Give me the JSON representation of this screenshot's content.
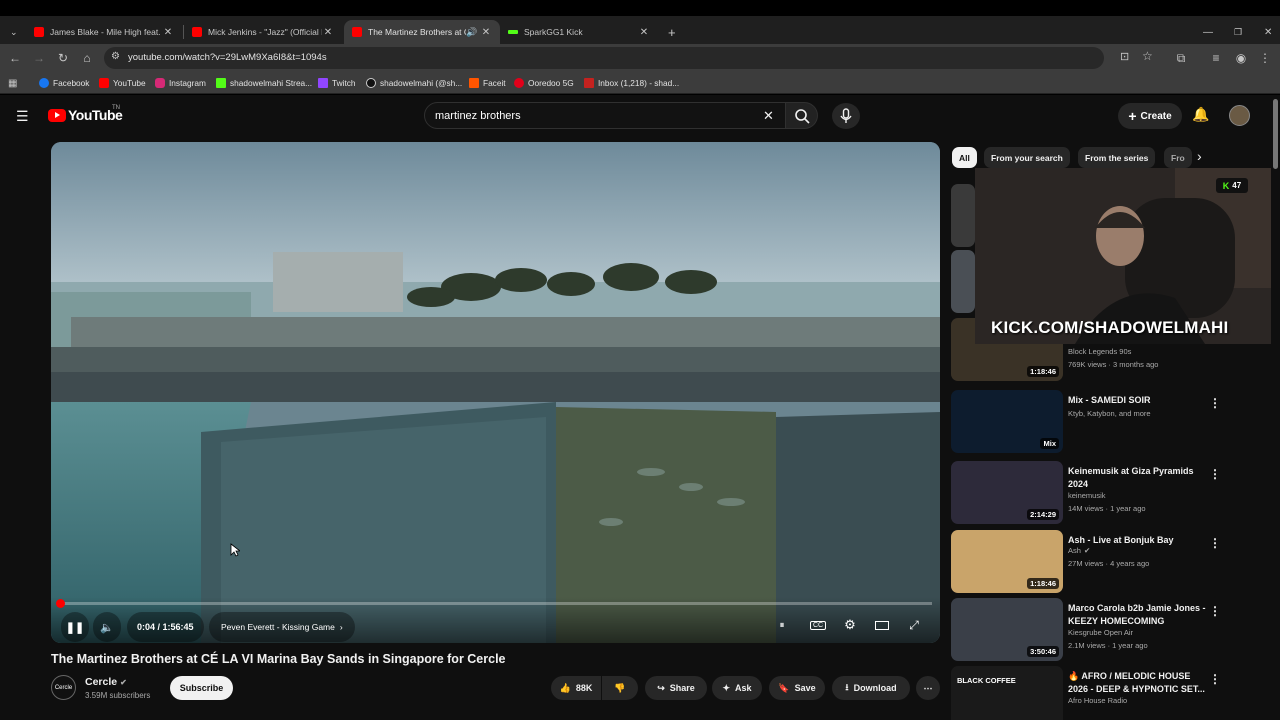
{
  "browser": {
    "tabs": [
      {
        "title": "James Blake - Mile High feat. Tr",
        "fav_color": "#ff0000"
      },
      {
        "title": "Mick Jenkins - \"Jazz\" (Official M",
        "fav_color": "#ff0000"
      },
      {
        "title": "The Martinez Brothers at CÉ",
        "fav_color": "#ff0000",
        "active": true
      },
      {
        "title": "SparkGG1 Kick",
        "fav_color": "#53fc18"
      }
    ],
    "url": "youtube.com/watch?v=29LwM9Xa6I8&t=1094s",
    "bookmarks": [
      {
        "label": "Facebook",
        "color": "#1877f2"
      },
      {
        "label": "YouTube",
        "color": "#ff0000"
      },
      {
        "label": "Instagram",
        "color": "#d62976"
      },
      {
        "label": "shadowelmahi Strea...",
        "color": "#53fc18"
      },
      {
        "label": "Twitch",
        "color": "#9146ff"
      },
      {
        "label": "shadowelmahi (@sh...",
        "color": "#111111"
      },
      {
        "label": "Faceit",
        "color": "#ff5500"
      },
      {
        "label": "Ooredoo 5G",
        "color": "#e2001a"
      },
      {
        "label": "Inbox (1,218) - shad...",
        "color": "#c5221f"
      }
    ]
  },
  "youtube": {
    "logo_text": "YouTube",
    "country_code": "TN",
    "search_value": "martinez brothers",
    "create_label": "Create"
  },
  "player": {
    "progress_fraction": 0.0007,
    "time_display": "0:04 / 1:56:45",
    "chapter": "Peven Everett - Kissing Game"
  },
  "video": {
    "title": "The Martinez Brothers at CÉ LA VI Marina Bay Sands in Singapore for Cercle",
    "channel": "Cercle",
    "subscribers": "3.59M subscribers",
    "subscribe_label": "Subscribe",
    "avatar_text": "Cercle",
    "likes": "88K",
    "share_label": "Share",
    "ask_label": "Ask",
    "save_label": "Save",
    "download_label": "Download"
  },
  "chips": [
    "All",
    "From your search",
    "From the series",
    "Fro"
  ],
  "overlay": {
    "kick_count": "47",
    "kick_text": "KICK.COM/SHADOWELMAHI"
  },
  "recommendations": [
    {
      "title": "",
      "channel": "Block Legends 90s",
      "meta": "769K views · 3 months ago",
      "duration": "1:18:46",
      "thumb": "#3a3226"
    },
    {
      "title": "Mix - SAMEDI SOIR",
      "channel": "Ktyb, Katybon, and more",
      "meta": "",
      "duration": "Mix",
      "thumb": "#0d1c2e"
    },
    {
      "title": "Keinemusik at Giza Pyramids 2024",
      "channel": "keinemusik",
      "meta": "14M views · 1 year ago",
      "duration": "2:14:29",
      "thumb": "#2d2a3a"
    },
    {
      "title": "Ash - Live at Bonjuk Bay",
      "channel": "Ash",
      "meta": "27M views · 4 years ago",
      "duration": "1:18:46",
      "thumb": "#c9a46a"
    },
    {
      "title": "Marco Carola b2b Jamie Jones - KEEZY HOMECOMING",
      "channel": "Kiesgrube Open Air",
      "meta": "2.1M views · 1 year ago",
      "duration": "3:50:46",
      "thumb": "#3a3f48"
    },
    {
      "title": "🔥 AFRO / MELODIC HOUSE 2026 - DEEP & HYPNOTIC SET...",
      "channel": "Afro House Radio",
      "meta": "",
      "duration": "",
      "thumb": "#1a1a1a",
      "thumb_text": "BLACK COFFEE"
    }
  ],
  "colors": {
    "accent": "#ff0000",
    "kick_green": "#53fc18",
    "background": "#0f0f0f"
  }
}
